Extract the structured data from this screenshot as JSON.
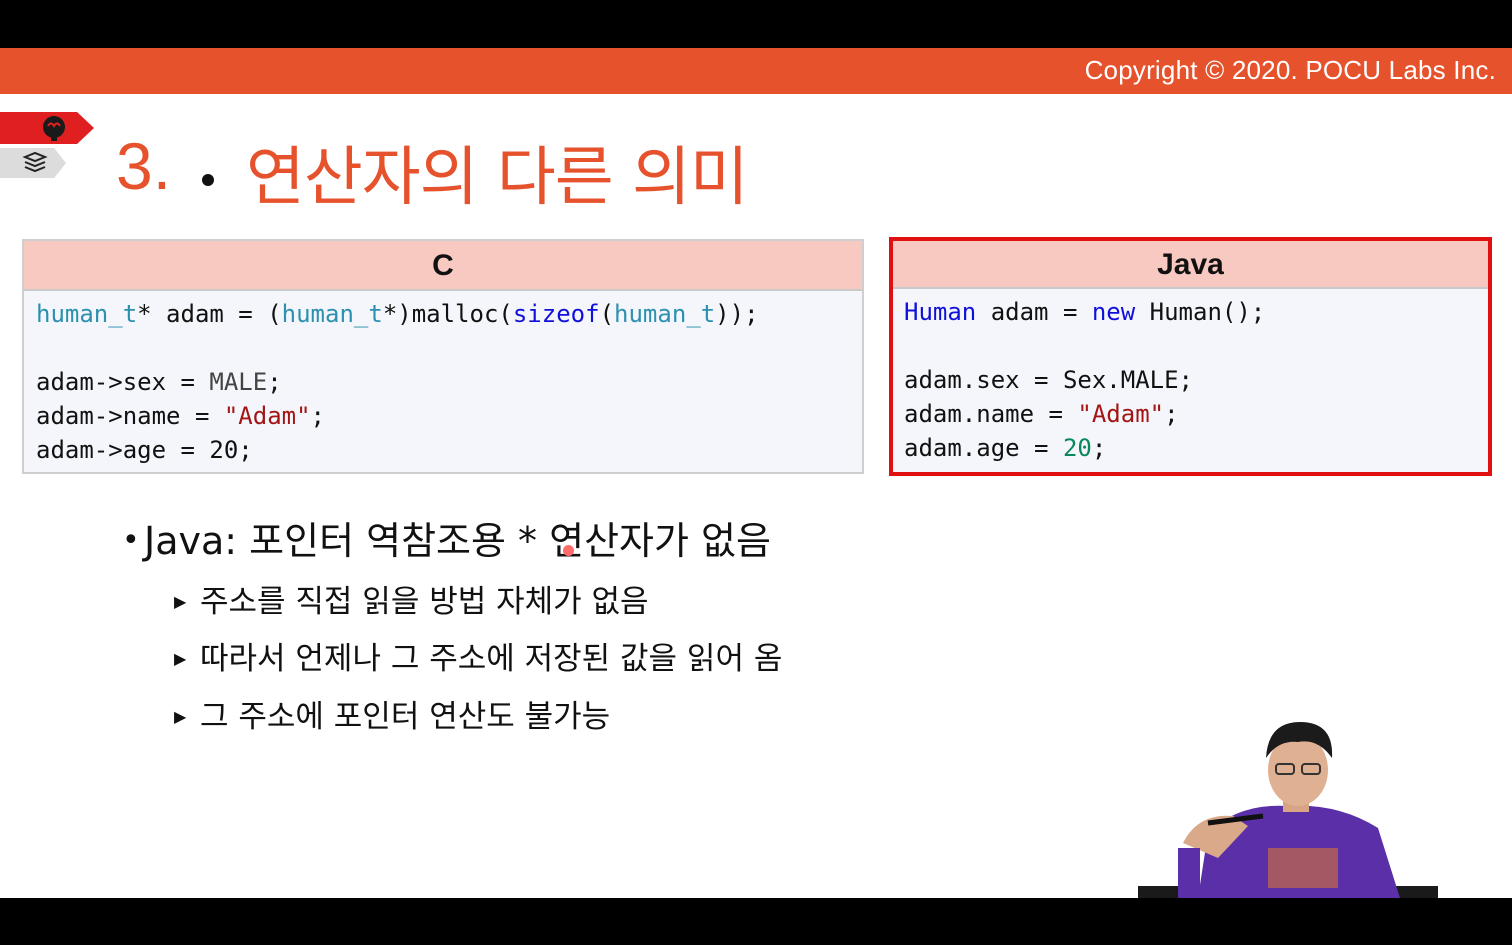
{
  "header": {
    "copyright": "Copyright © 2020. POCU Labs Inc."
  },
  "slide": {
    "title_number": "3.",
    "title_text": "연산자의 다른 의미"
  },
  "c_panel": {
    "header": "C",
    "lines": [
      [
        {
          "t": "human_t",
          "c": "teal"
        },
        {
          "t": "* adam = (",
          "c": "plain"
        },
        {
          "t": "human_t",
          "c": "teal"
        },
        {
          "t": "*)malloc(",
          "c": "plain"
        },
        {
          "t": "sizeof",
          "c": "blue"
        },
        {
          "t": "(",
          "c": "plain"
        },
        {
          "t": "human_t",
          "c": "teal"
        },
        {
          "t": "));",
          "c": "plain"
        }
      ],
      [],
      [
        {
          "t": "adam->sex = ",
          "c": "plain"
        },
        {
          "t": "MALE",
          "c": "gray"
        },
        {
          "t": ";",
          "c": "plain"
        }
      ],
      [
        {
          "t": "adam->name = ",
          "c": "plain"
        },
        {
          "t": "\"Adam\"",
          "c": "str"
        },
        {
          "t": ";",
          "c": "plain"
        }
      ],
      [
        {
          "t": "adam->age = 20;",
          "c": "plain"
        }
      ]
    ]
  },
  "java_panel": {
    "header": "Java",
    "lines": [
      [
        {
          "t": "Human",
          "c": "blue"
        },
        {
          "t": " adam = ",
          "c": "plain"
        },
        {
          "t": "new",
          "c": "blue"
        },
        {
          "t": " Human();",
          "c": "plain"
        }
      ],
      [],
      [
        {
          "t": "adam.sex = Sex.MALE;",
          "c": "plain"
        }
      ],
      [
        {
          "t": "adam.name = ",
          "c": "plain"
        },
        {
          "t": "\"Adam\"",
          "c": "str"
        },
        {
          "t": ";",
          "c": "plain"
        }
      ],
      [
        {
          "t": "adam.age = ",
          "c": "plain"
        },
        {
          "t": "20",
          "c": "num"
        },
        {
          "t": ";",
          "c": "plain"
        }
      ]
    ]
  },
  "bullets": {
    "main": "Java: 포인터 역참조용 * 연산자가 없음",
    "sub": [
      "주소를 직접 읽을 방법 자체가 없음",
      "따라서 언제나 그 주소에 저장된 값을 읽어 옴",
      "그 주소에 포인터 연산도 불가능"
    ]
  },
  "colors": {
    "accent": "#e6522c",
    "highlight_border": "#e01010",
    "code_header_bg": "#f7c9c0",
    "code_bg": "#f4f6fb"
  },
  "icons": {
    "brain": "brain-icon",
    "books": "books-icon",
    "bullet": "bullet-dot-icon",
    "sub_bullet": "triangle-bullet-icon"
  }
}
